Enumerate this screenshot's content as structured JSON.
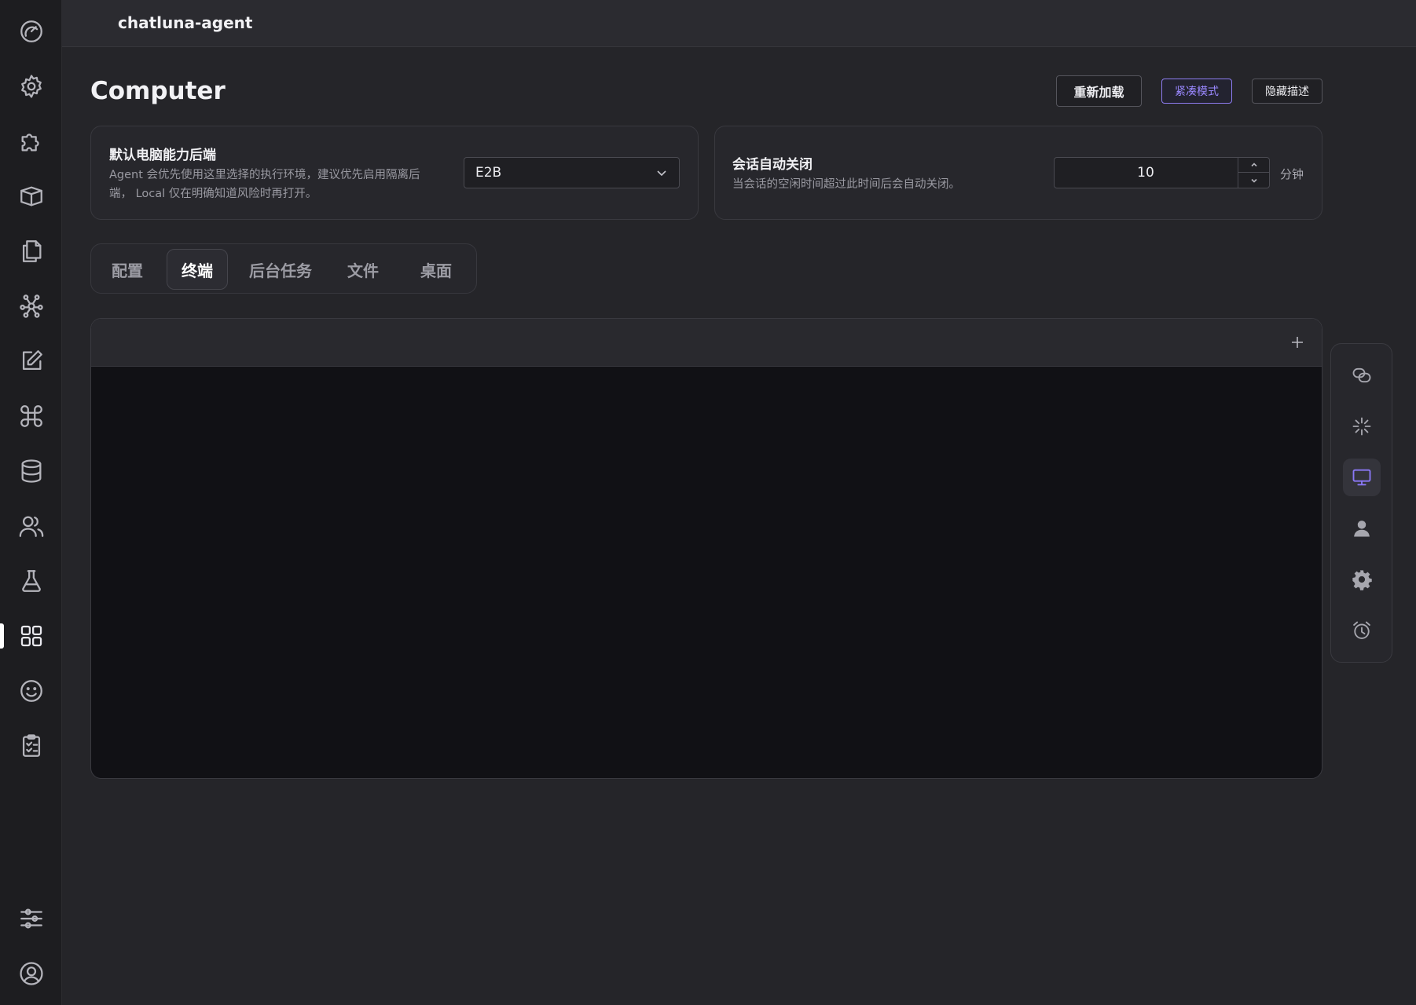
{
  "app": {
    "title": "chatluna-agent"
  },
  "sidebar": {
    "items": [
      {
        "icon": "dashboard-gauge-icon"
      },
      {
        "icon": "settings-gear-icon"
      },
      {
        "icon": "plugins-puzzle-icon"
      },
      {
        "icon": "market-box-icon"
      },
      {
        "icon": "documents-copy-icon"
      },
      {
        "icon": "network-graph-icon"
      },
      {
        "icon": "edit-note-icon"
      },
      {
        "icon": "command-key-icon"
      },
      {
        "icon": "database-icon"
      },
      {
        "icon": "users-icon"
      },
      {
        "icon": "lab-flask-icon"
      },
      {
        "icon": "apps-grid-icon",
        "active": true
      },
      {
        "icon": "smiley-face-icon"
      },
      {
        "icon": "clipboard-checklist-icon"
      }
    ],
    "bottom_items": [
      {
        "icon": "sliders-icon"
      },
      {
        "icon": "user-account-icon"
      }
    ]
  },
  "page": {
    "title": "Computer",
    "actions": {
      "reload": "重新加载",
      "compact": "紧凑模式",
      "hide_desc": "隐藏描述"
    }
  },
  "settings": {
    "backend": {
      "title": "默认电脑能力后端",
      "desc_line1": "Agent 会优先使用这里选择的执行环境，建议优先启用隔离后",
      "desc_line2": "端， Local 仅在明确知道风险时再打开。",
      "value": "E2B"
    },
    "auto_close": {
      "title": "会话自动关闭",
      "desc": "当会话的空闲时间超过此时间后会自动关闭。",
      "value": "10",
      "unit": "分钟"
    }
  },
  "tabs": [
    {
      "label": "配置"
    },
    {
      "label": "终端",
      "active": true
    },
    {
      "label": "后台任务"
    },
    {
      "label": "文件"
    },
    {
      "label": "桌面"
    }
  ],
  "terminal": {
    "add_icon": "plus-icon"
  },
  "float_toolbar": {
    "items": [
      {
        "icon": "link-chain-icon"
      },
      {
        "icon": "sparkle-burst-icon"
      },
      {
        "icon": "monitor-icon",
        "active": true
      },
      {
        "icon": "person-icon"
      },
      {
        "icon": "cog-icon"
      },
      {
        "icon": "alarm-clock-icon"
      }
    ]
  },
  "colors": {
    "background": "#252529",
    "sidebar": "#1d1d20",
    "accent": "#8a78f5",
    "terminal": "#111115"
  }
}
